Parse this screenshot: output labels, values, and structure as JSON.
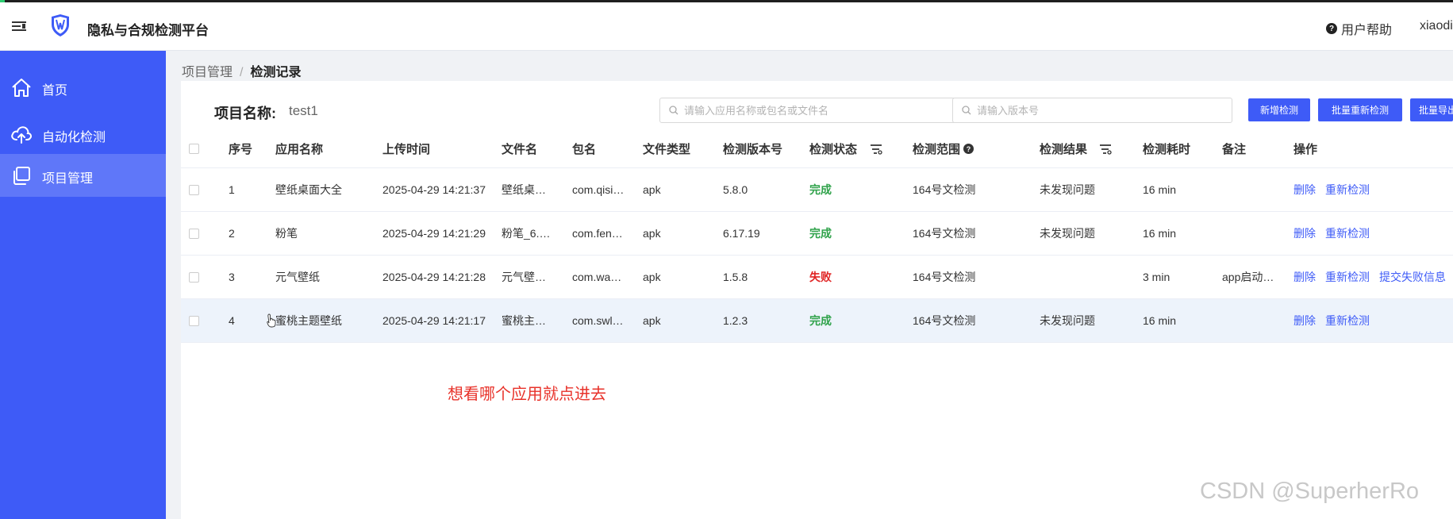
{
  "header": {
    "app_title": "隐私与合规检测平台",
    "help_label": "用户帮助",
    "username": "xiaodi"
  },
  "sidebar": {
    "items": [
      {
        "label": "首页",
        "icon": "home-icon",
        "active": false
      },
      {
        "label": "自动化检测",
        "icon": "cloud-upload-icon",
        "active": false
      },
      {
        "label": "项目管理",
        "icon": "copy-icon",
        "active": true
      }
    ]
  },
  "breadcrumb": {
    "parent": "项目管理",
    "current": "检测记录"
  },
  "project": {
    "label": "项目名称:",
    "name": "test1"
  },
  "filters": {
    "app_search_placeholder": "请输入应用名称或包名或文件名",
    "version_search_placeholder": "请输入版本号"
  },
  "buttons": {
    "add": "新增检测",
    "batch_retest": "批量重新检测",
    "batch_export": "批量导出"
  },
  "table": {
    "headers": {
      "index": "序号",
      "app_name": "应用名称",
      "upload_time": "上传时间",
      "file_name": "文件名",
      "package": "包名",
      "file_type": "文件类型",
      "version": "检测版本号",
      "status": "检测状态",
      "scope": "检测范围",
      "result": "检测结果",
      "duration": "检测耗时",
      "remark": "备注",
      "actions": "操作"
    },
    "rows": [
      {
        "index": "1",
        "app_name": "壁纸桌面大全",
        "upload_time": "2025-04-29 14:21:37",
        "file_name": "壁纸桌…",
        "package": "com.qisi…",
        "file_type": "apk",
        "version": "5.8.0",
        "status": "完成",
        "scope": "164号文检测",
        "result": "未发现问题",
        "duration": "16 min",
        "remark": "",
        "actions": [
          "删除",
          "重新检测"
        ]
      },
      {
        "index": "2",
        "app_name": "粉笔",
        "upload_time": "2025-04-29 14:21:29",
        "file_name": "粉笔_6.…",
        "package": "com.fen…",
        "file_type": "apk",
        "version": "6.17.19",
        "status": "完成",
        "scope": "164号文检测",
        "result": "未发现问题",
        "duration": "16 min",
        "remark": "",
        "actions": [
          "删除",
          "重新检测"
        ]
      },
      {
        "index": "3",
        "app_name": "元气壁纸",
        "upload_time": "2025-04-29 14:21:28",
        "file_name": "元气壁…",
        "package": "com.wa…",
        "file_type": "apk",
        "version": "1.5.8",
        "status": "失败",
        "scope": "164号文检测",
        "result": "",
        "duration": "3 min",
        "remark": "app启动…",
        "actions": [
          "删除",
          "重新检测",
          "提交失败信息"
        ]
      },
      {
        "index": "4",
        "app_name": "蜜桃主题壁纸",
        "upload_time": "2025-04-29 14:21:17",
        "file_name": "蜜桃主…",
        "package": "com.swl…",
        "file_type": "apk",
        "version": "1.2.3",
        "status": "完成",
        "scope": "164号文检测",
        "result": "未发现问题",
        "duration": "16 min",
        "remark": "",
        "actions": [
          "删除",
          "重新检测"
        ]
      }
    ]
  },
  "annotation": "想看哪个应用就点进去",
  "watermark": "CSDN @SuperherRo",
  "colors": {
    "sidebar": "#3e5bf7",
    "primary": "#3e5bf7",
    "success": "#2fa24a",
    "fail": "#e02424",
    "annotation": "#e8322a"
  }
}
